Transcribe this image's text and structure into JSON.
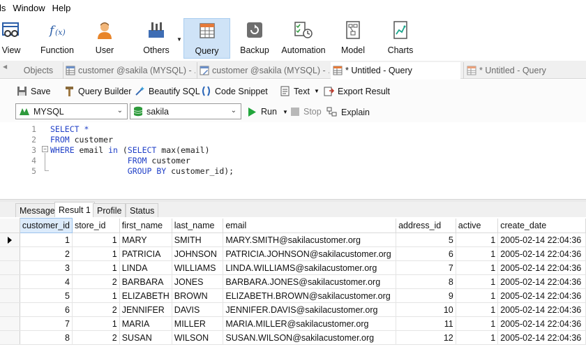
{
  "menubar": {
    "items": [
      "ls",
      "Window",
      "Help"
    ]
  },
  "toolbar": {
    "buttons": [
      {
        "label": "View",
        "icon": "view-icon"
      },
      {
        "label": "Function",
        "icon": "function-icon"
      },
      {
        "label": "User",
        "icon": "user-icon"
      },
      {
        "label": "Others",
        "icon": "others-icon"
      },
      {
        "label": "Query",
        "icon": "query-icon",
        "active": true
      },
      {
        "label": "Backup",
        "icon": "backup-icon"
      },
      {
        "label": "Automation",
        "icon": "automation-icon"
      },
      {
        "label": "Model",
        "icon": "model-icon"
      },
      {
        "label": "Charts",
        "icon": "charts-icon"
      }
    ],
    "active_color": "#cfe3f7"
  },
  "tabs": [
    {
      "label": "Objects"
    },
    {
      "label": "customer @sakila (MYSQL) - ..."
    },
    {
      "label": "customer @sakila (MYSQL) - ..."
    },
    {
      "label": "* Untitled - Query",
      "active": true
    },
    {
      "label": "* Untitled - Query"
    }
  ],
  "query_toolbar": {
    "save": "Save",
    "query_builder": "Query Builder",
    "beautify": "Beautify SQL",
    "snippet": "Code Snippet",
    "text": "Text",
    "export": "Export Result"
  },
  "connection": {
    "server": "MYSQL",
    "database": "sakila",
    "run": "Run",
    "stop": "Stop",
    "explain": "Explain"
  },
  "editor": {
    "lines": [
      {
        "num": "1",
        "tokens": [
          {
            "t": "SELECT *",
            "k": "kw"
          }
        ]
      },
      {
        "num": "2",
        "tokens": [
          {
            "t": "FROM",
            "k": "kw"
          },
          {
            "t": " customer",
            "k": "id"
          }
        ]
      },
      {
        "num": "3",
        "tokens": [
          {
            "t": "WHERE",
            "k": "kw"
          },
          {
            "t": " email ",
            "k": "id"
          },
          {
            "t": "in",
            "k": "kw"
          },
          {
            "t": " (",
            "k": "id"
          },
          {
            "t": "SELECT",
            "k": "kw"
          },
          {
            "t": " max(email)",
            "k": "id"
          }
        ]
      },
      {
        "num": "4",
        "tokens": [
          {
            "t": "                FROM",
            "k": "kw"
          },
          {
            "t": " customer",
            "k": "id"
          }
        ]
      },
      {
        "num": "5",
        "tokens": [
          {
            "t": "                GROUP BY",
            "k": "kw"
          },
          {
            "t": " customer_id);",
            "k": "id"
          }
        ]
      }
    ]
  },
  "result_tabs": [
    {
      "label": "Message"
    },
    {
      "label": "Result 1",
      "active": true
    },
    {
      "label": "Profile"
    },
    {
      "label": "Status"
    }
  ],
  "grid": {
    "columns": [
      "customer_id",
      "store_id",
      "first_name",
      "last_name",
      "email",
      "address_id",
      "active",
      "create_date"
    ],
    "numeric": [
      true,
      true,
      false,
      false,
      false,
      true,
      true,
      false
    ],
    "rows": [
      [
        "1",
        "1",
        "MARY",
        "SMITH",
        "MARY.SMITH@sakilacustomer.org",
        "5",
        "1",
        "2005-02-14 22:04:36"
      ],
      [
        "2",
        "1",
        "PATRICIA",
        "JOHNSON",
        "PATRICIA.JOHNSON@sakilacustomer.org",
        "6",
        "1",
        "2005-02-14 22:04:36"
      ],
      [
        "3",
        "1",
        "LINDA",
        "WILLIAMS",
        "LINDA.WILLIAMS@sakilacustomer.org",
        "7",
        "1",
        "2005-02-14 22:04:36"
      ],
      [
        "4",
        "2",
        "BARBARA",
        "JONES",
        "BARBARA.JONES@sakilacustomer.org",
        "8",
        "1",
        "2005-02-14 22:04:36"
      ],
      [
        "5",
        "1",
        "ELIZABETH",
        "BROWN",
        "ELIZABETH.BROWN@sakilacustomer.org",
        "9",
        "1",
        "2005-02-14 22:04:36"
      ],
      [
        "6",
        "2",
        "JENNIFER",
        "DAVIS",
        "JENNIFER.DAVIS@sakilacustomer.org",
        "10",
        "1",
        "2005-02-14 22:04:36"
      ],
      [
        "7",
        "1",
        "MARIA",
        "MILLER",
        "MARIA.MILLER@sakilacustomer.org",
        "11",
        "1",
        "2005-02-14 22:04:36"
      ],
      [
        "8",
        "2",
        "SUSAN",
        "WILSON",
        "SUSAN.WILSON@sakilacustomer.org",
        "12",
        "1",
        "2005-02-14 22:04:36"
      ]
    ],
    "selected_row": 0
  }
}
